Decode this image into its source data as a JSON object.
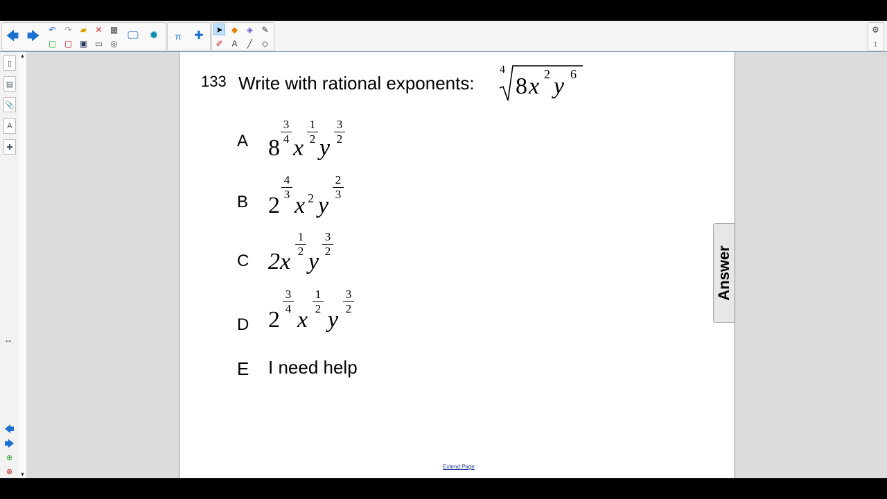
{
  "toolbar": {
    "icons": [
      "back-arrow",
      "forward-arrow",
      "undo",
      "redo",
      "open",
      "delete",
      "table",
      "new-page",
      "delete-page",
      "save",
      "screen-shade",
      "display",
      "record",
      "add-ons",
      "math-tools",
      "select",
      "shapes",
      "eraser",
      "pen",
      "creative-pen",
      "text",
      "line",
      "fill"
    ],
    "settings_icon": "gear-icon"
  },
  "question": {
    "number": "133",
    "text": "Write with rational exponents:",
    "radical_index": "4",
    "radicand": {
      "coef": "8",
      "x": "x",
      "x_exp": "2",
      "y": "y",
      "y_exp": "6"
    }
  },
  "options": [
    {
      "label": "A",
      "parts": [
        {
          "base": "8",
          "num": "3",
          "den": "4"
        },
        {
          "base": "x",
          "num": "1",
          "den": "2"
        },
        {
          "base": "y",
          "num": "3",
          "den": "2"
        }
      ]
    },
    {
      "label": "B",
      "parts": [
        {
          "base": "2",
          "num": "4",
          "den": "3"
        },
        {
          "base": "x",
          "exp": "2"
        },
        {
          "base": "y",
          "num": "2",
          "den": "3"
        }
      ]
    },
    {
      "label": "C",
      "parts": [
        {
          "base": "2x",
          "num": "1",
          "den": "2"
        },
        {
          "base": "y",
          "num": "3",
          "den": "2"
        }
      ]
    },
    {
      "label": "D",
      "parts": [
        {
          "base": "2",
          "num": "3",
          "den": "4"
        },
        {
          "base": "x",
          "num": "1",
          "den": "2"
        },
        {
          "base": "y",
          "num": "3",
          "den": "2"
        }
      ]
    },
    {
      "label": "E",
      "text": "I need help"
    }
  ],
  "answer_tab": "Answer",
  "extend_link": "Extend Page",
  "colors": {
    "accent": "#1a6fd1",
    "page_bg": "#ffffff",
    "canvas_bg": "#dcdcdc"
  }
}
